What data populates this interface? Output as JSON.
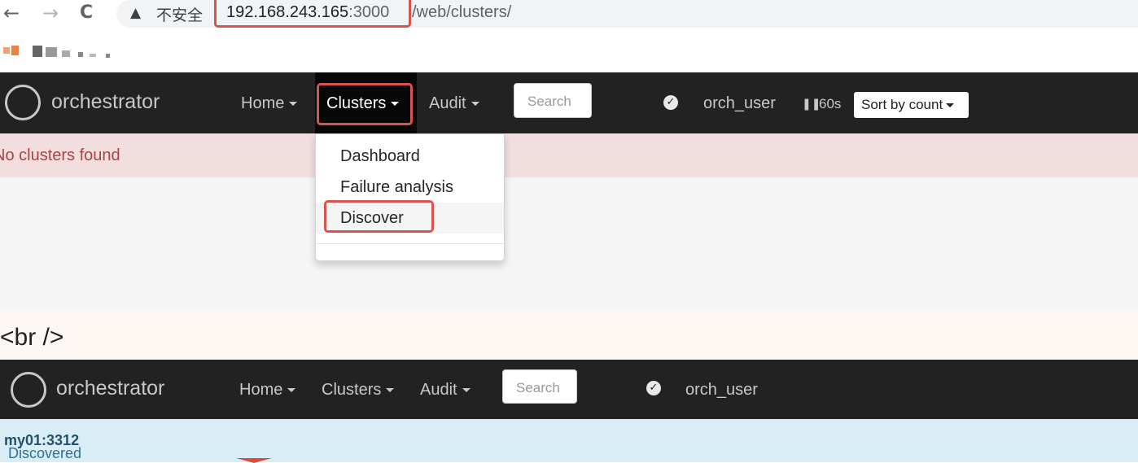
{
  "browser": {
    "back_icon": "←",
    "forward_icon": "→",
    "reload_icon": "C",
    "warning_icon": "▲",
    "insecure_label": "不安全",
    "url_host": "192.168.243.165",
    "url_port": ":3000",
    "url_path": "/web/clusters/"
  },
  "navbar_top": {
    "brand": "orchestrator",
    "home": "Home",
    "clusters": "Clusters",
    "audit": "Audit",
    "search_placeholder": "Search",
    "check_icon": "✓",
    "user": "orch_user",
    "pause_icon": "❚❚",
    "refresh": "60s",
    "sort": "Sort by count"
  },
  "alert_empty": "No clusters found",
  "clusters_menu": {
    "items": [
      "Dashboard",
      "Failure analysis",
      "Discover"
    ]
  },
  "banner_text": "<br />",
  "navbar_bottom": {
    "brand": "orchestrator",
    "home": "Home",
    "clusters": "Clusters",
    "audit": "Audit",
    "search_placeholder": "Search",
    "check_icon": "✓",
    "user": "orch_user"
  },
  "alert_discovered": {
    "prefix": "Discovered ",
    "instance": "my01:3312"
  },
  "colors": {
    "navbar": "#222222",
    "highlight": "#d9534f",
    "danger_bg": "#f2dede",
    "info_bg": "#d9edf7"
  }
}
